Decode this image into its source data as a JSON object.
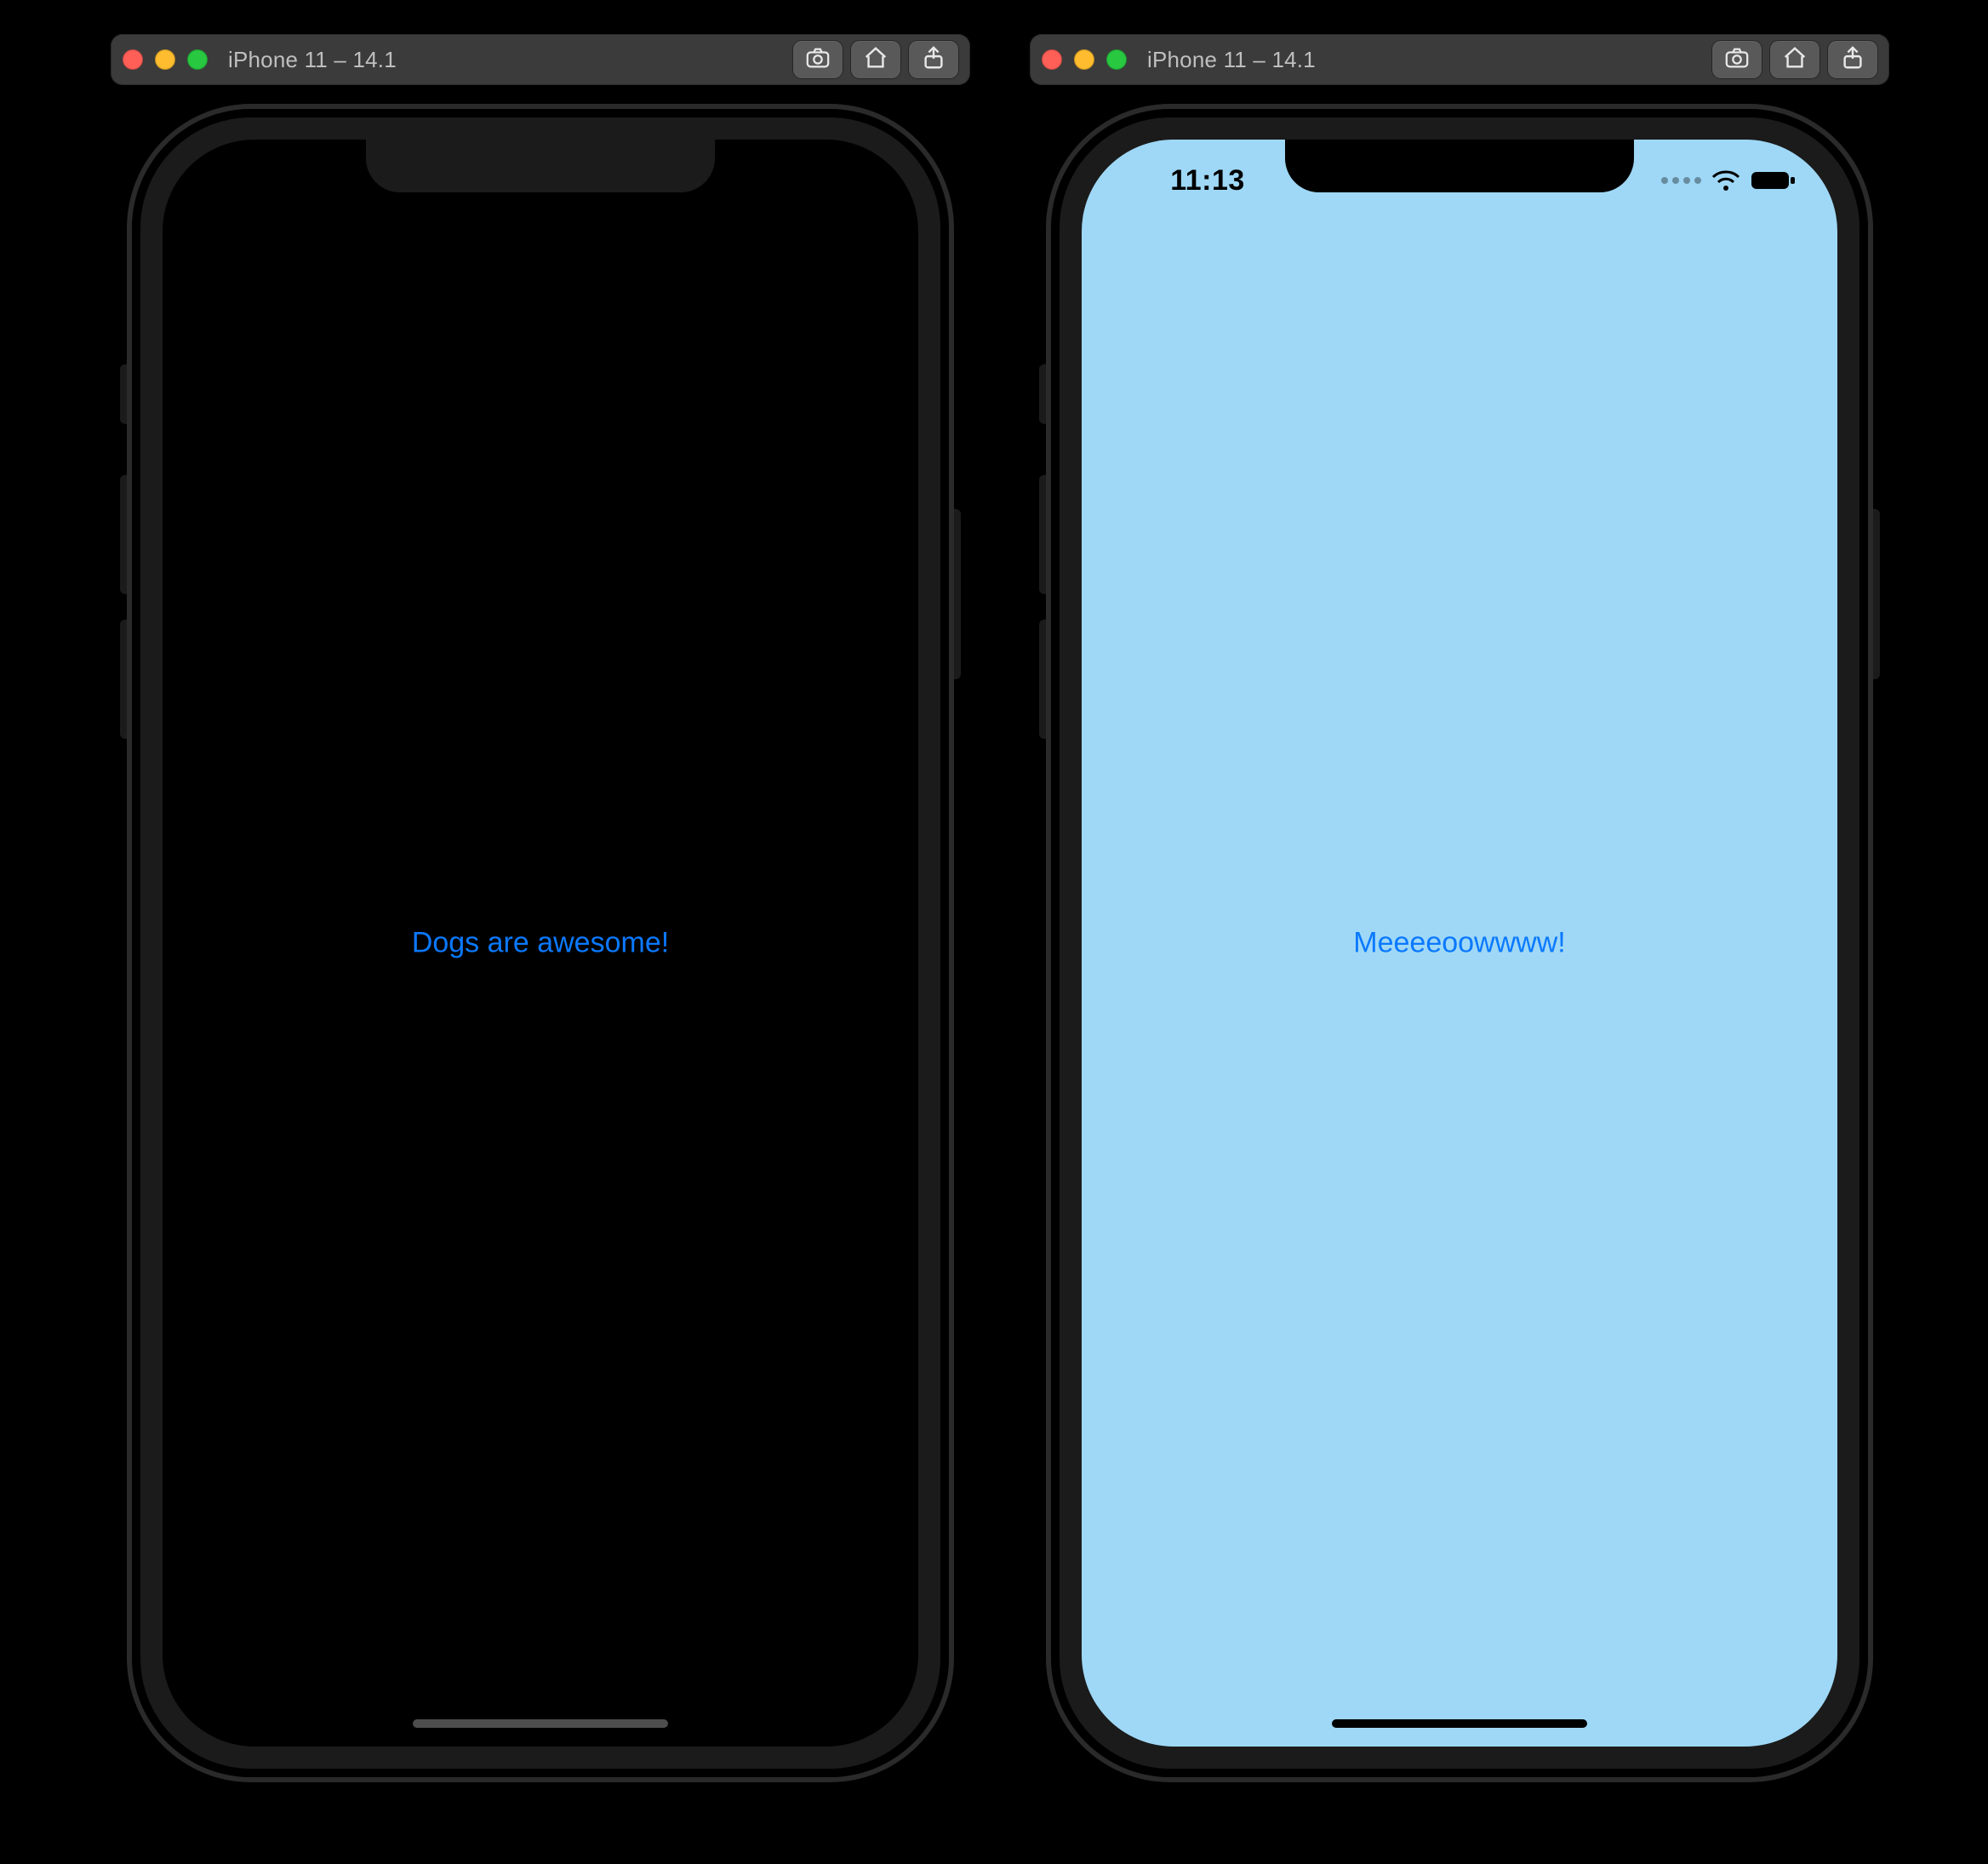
{
  "left": {
    "titlebar": {
      "title": "iPhone 11 – 14.1"
    },
    "screen": {
      "variant": "dark",
      "label": "Dogs are awesome!"
    }
  },
  "right": {
    "titlebar": {
      "title": "iPhone 11 – 14.1"
    },
    "screen": {
      "variant": "light",
      "label": "Meeeeoowwww!",
      "status": {
        "time": "11:13"
      }
    }
  },
  "icons": {
    "screenshot": "screenshot-icon",
    "home": "home-icon",
    "share": "share-icon",
    "wifi": "wifi-icon",
    "battery": "battery-icon",
    "signal": "signal-icon"
  },
  "colors": {
    "accent_link": "#0b79ff",
    "light_screen_bg": "#9fd8f6",
    "dark_screen_bg": "#000000",
    "titlebar_bg": "#3b3b3b"
  }
}
